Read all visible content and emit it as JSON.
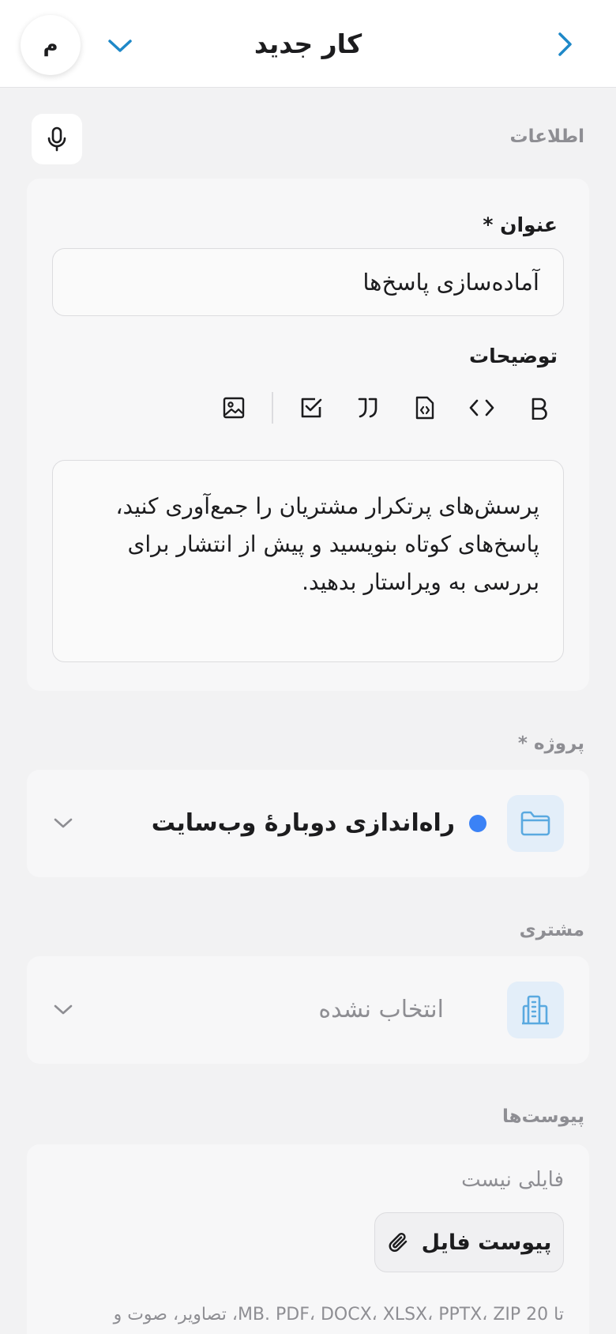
{
  "header": {
    "title": "کار جدید",
    "avatar_initial": "م"
  },
  "info_section": {
    "label": "اطلاعات",
    "title_label": "عنوان *",
    "title_value": "آماده‌سازی پاسخ‌ها",
    "description_label": "توضیحات",
    "description_value": "پرسش‌های پرتکرار مشتریان را جمع‌آوری کنید، پاسخ‌های کوتاه بنویسید و پیش از انتشار برای بررسی به ویراستار بدهید."
  },
  "toolbar": {
    "items": [
      "bold-icon",
      "code-icon",
      "code-file-icon",
      "quote-icon",
      "checkbox-icon",
      "image-icon"
    ]
  },
  "project": {
    "label": "پروژه *",
    "value": "راه‌اندازی دوبارهٔ وب‌سایت",
    "dot_color": "#3b82f6"
  },
  "customer": {
    "label": "مشتری",
    "value": "انتخاب نشده"
  },
  "attachments": {
    "label": "پیوست‌ها",
    "empty_text": "فایلی نیست",
    "button_label": "پیوست فایل",
    "hint": "تا 20 MB. PDF، DOCX، XLSX، PPTX، ZIP، تصاویر، صوت و"
  },
  "colors": {
    "accent": "#1e88c8",
    "icon_blue": "#5aa9e0",
    "background": "#f2f2f3"
  }
}
